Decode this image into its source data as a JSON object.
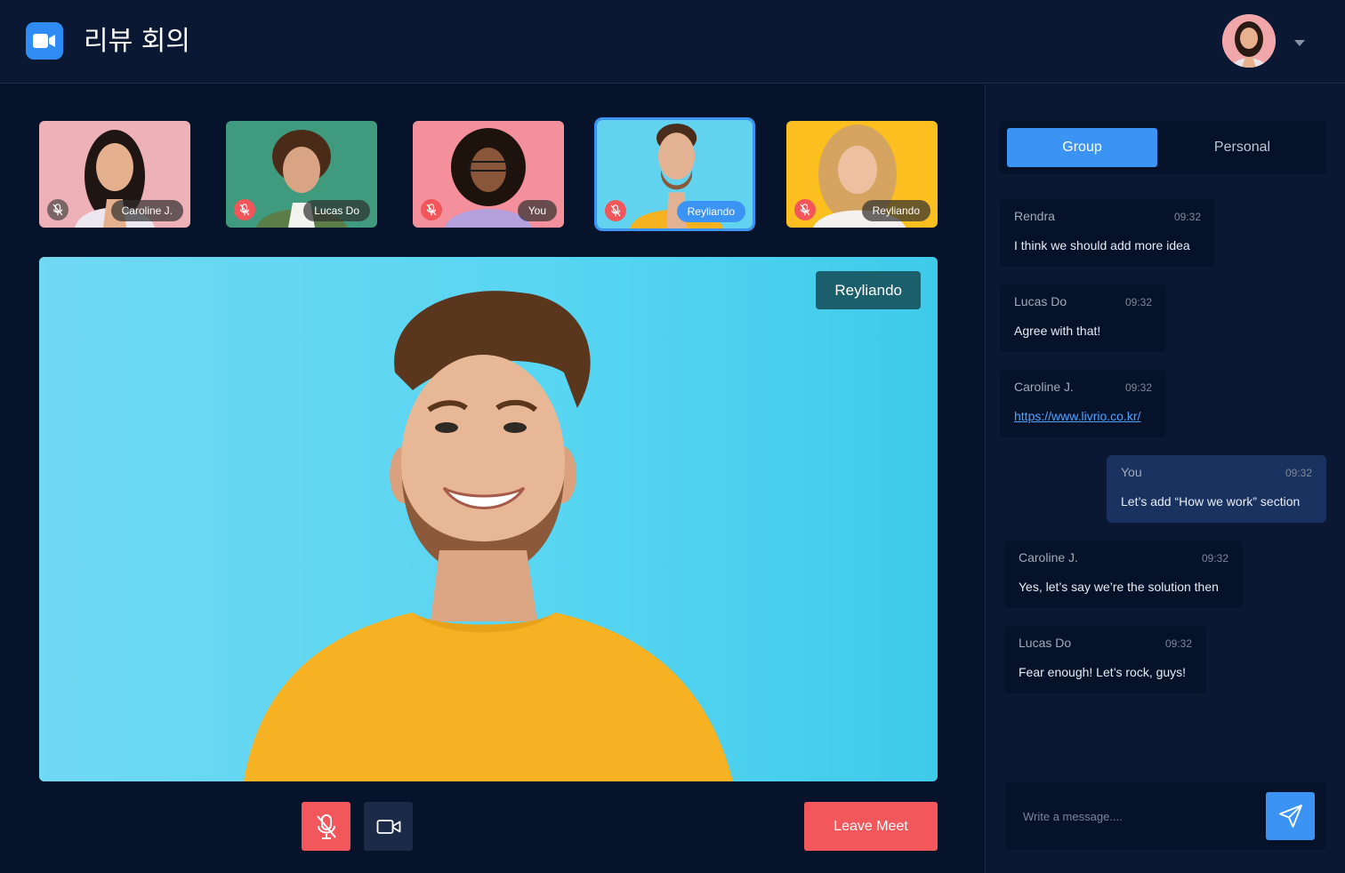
{
  "header": {
    "title": "리뷰 회의",
    "logo_icon": "video-camera-icon",
    "avatar_icon": "user-avatar",
    "menu_icon": "chevron-down-icon"
  },
  "participants": [
    {
      "name": "Caroline J.",
      "mic": "muted",
      "bg": "#ecaab0"
    },
    {
      "name": "Lucas Do",
      "mic": "muted",
      "bg": "#3f9c7f"
    },
    {
      "name": "You",
      "mic": "muted",
      "bg": "#f4909a"
    },
    {
      "name": "Reyliando",
      "mic": "muted",
      "bg": "#5fd2ee",
      "active": true
    },
    {
      "name": "Reyliando",
      "mic": "muted",
      "bg": "#fbc21d"
    }
  ],
  "stage": {
    "speaker": "Reyliando"
  },
  "controls": {
    "mic_icon": "mic-off-icon",
    "camera_icon": "video-camera-icon",
    "leave_label": "Leave Meet"
  },
  "chat": {
    "tabs": {
      "group": "Group",
      "personal": "Personal"
    },
    "messages": [
      {
        "sender": "Rendra",
        "time": "09:32",
        "text": "I think we should add more idea"
      },
      {
        "sender": "Lucas Do",
        "time": "09:32",
        "text": "Agree with that!"
      },
      {
        "sender": "Caroline J.",
        "time": "09:32",
        "text": "https://www.livrio.co.kr/"
      },
      {
        "sender": "You",
        "time": "09:32",
        "text": "Let’s add “How we work” section"
      },
      {
        "sender": "Caroline J.",
        "time": "09:32",
        "text": "Yes, let’s say we’re the solution then"
      },
      {
        "sender": "Lucas Do",
        "time": "09:32",
        "text": "Fear enough! Let’s rock, guys!"
      }
    ],
    "composer": {
      "placeholder": "Write a message....",
      "send_icon": "send-icon"
    }
  },
  "colors": {
    "accent": "#3b93f3",
    "danger": "#f2575b",
    "background": "#07132a"
  }
}
